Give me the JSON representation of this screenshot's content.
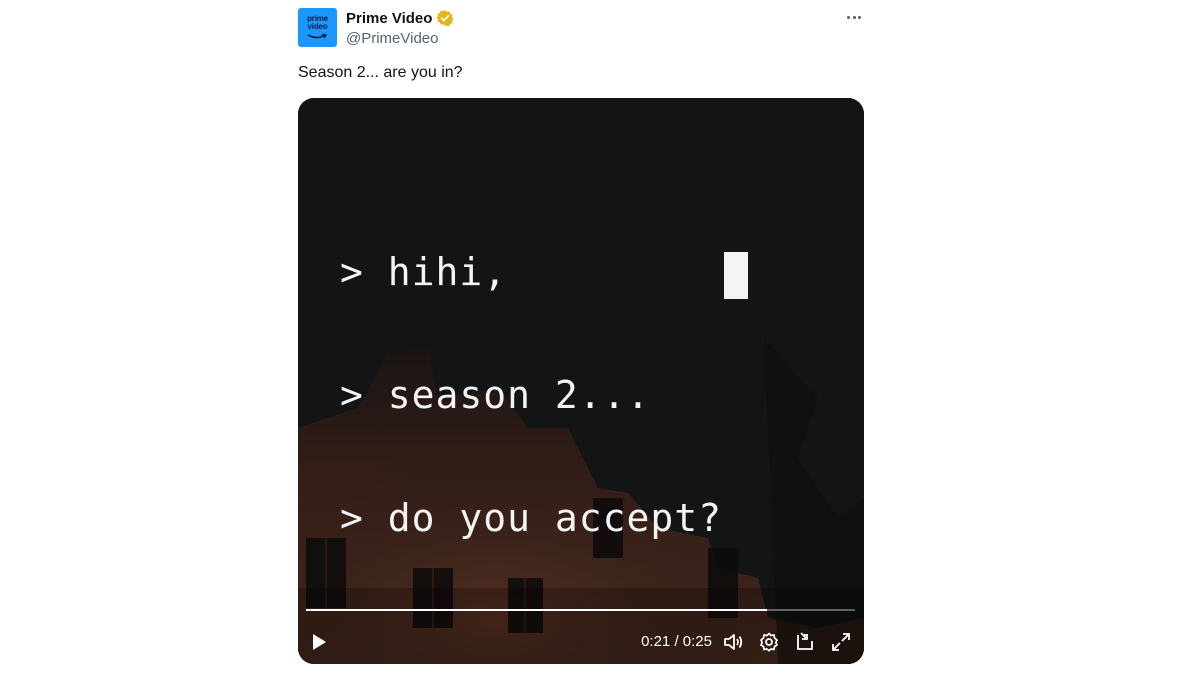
{
  "account": {
    "avatar_text_line1": "prime",
    "avatar_text_line2": "video",
    "display_name": "Prime Video",
    "handle": "@PrimeVideo",
    "verified": true
  },
  "tweet": {
    "text": "Season 2... are you in?"
  },
  "video": {
    "terminal_lines": [
      "> hihi,",
      "> season 2...",
      "> do you accept?"
    ],
    "current_time": "0:21",
    "separator": "/",
    "duration": "0:25",
    "progress": 0.84
  },
  "icons": {
    "more": "more-horizontal-icon",
    "verified": "verified-badge-icon",
    "play": "play-icon",
    "volume": "volume-icon",
    "settings": "gear-icon",
    "pip": "picture-in-picture-icon",
    "fullscreen": "fullscreen-icon"
  },
  "colors": {
    "brand_blue": "#1a98ff",
    "verified_gold": "#e2b719",
    "video_bg": "#121416",
    "secondary_text": "#536471"
  }
}
